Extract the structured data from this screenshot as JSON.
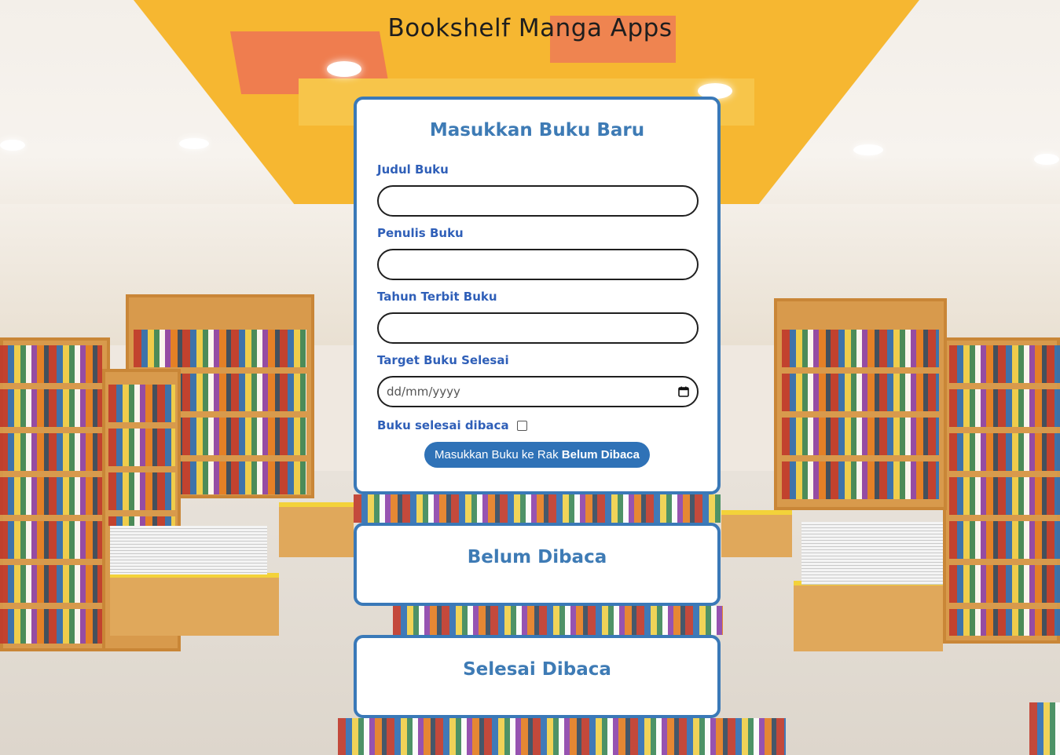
{
  "app": {
    "title": "Bookshelf Manga Apps"
  },
  "form": {
    "title": "Masukkan Buku Baru",
    "fields": [
      {
        "label": "Judul Buku",
        "value": "",
        "type": "text"
      },
      {
        "label": "Penulis Buku",
        "value": "",
        "type": "text"
      },
      {
        "label": "Tahun Terbit Buku",
        "value": "",
        "type": "number"
      },
      {
        "label": "Target Buku Selesai",
        "value": "",
        "placeholder": "dd/mm/yyyy",
        "type": "date",
        "icon": "calendar-icon"
      }
    ],
    "checkbox": {
      "label": "Buku selesai dibaca",
      "checked": false
    },
    "submit": {
      "prefix": "Masukkan Buku ke Rak ",
      "shelf": "Belum Dibaca"
    }
  },
  "shelves": {
    "unread": {
      "title": "Belum Dibaca"
    },
    "done": {
      "title": "Selesai Dibaca"
    }
  },
  "colors": {
    "accent": "#3a79b8",
    "label": "#2f5fb8",
    "button": "#2f72b7",
    "background_ceiling": "#f6b731"
  }
}
